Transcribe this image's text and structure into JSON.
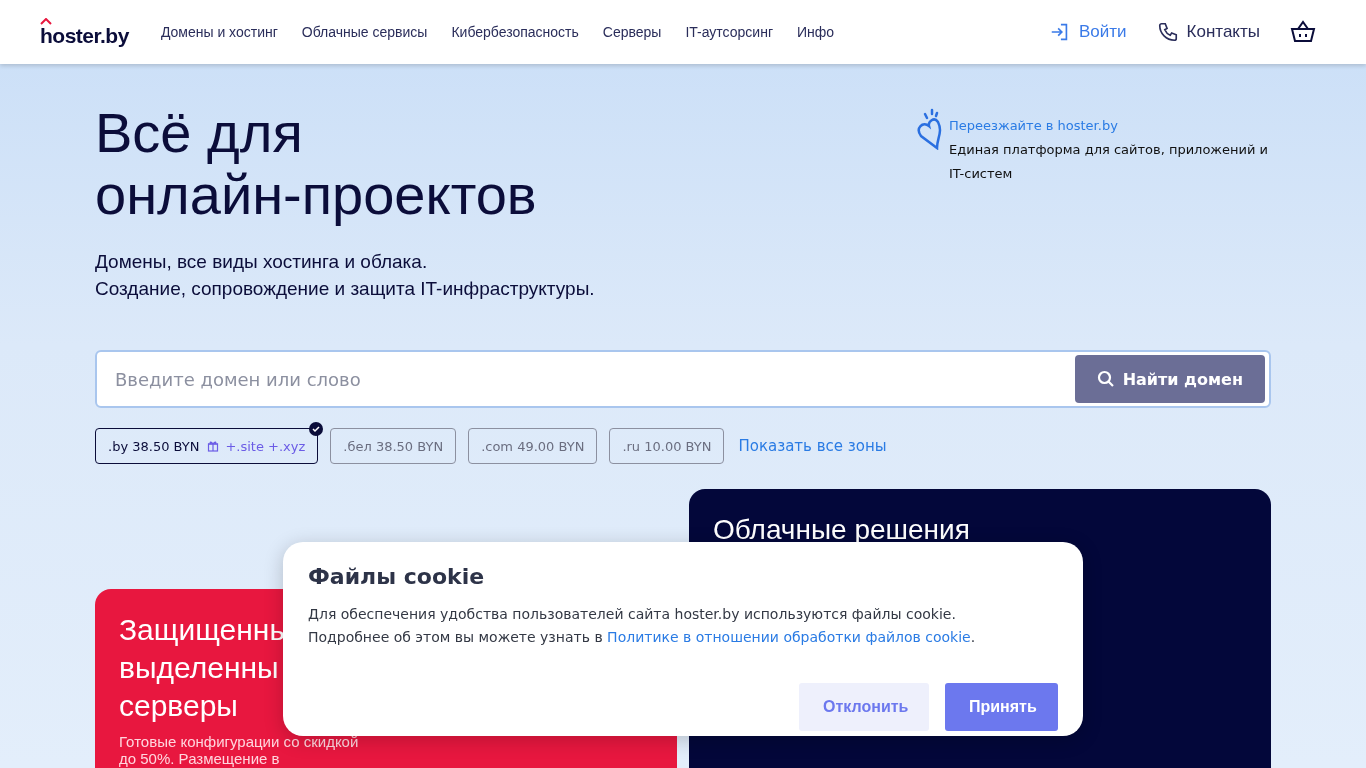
{
  "header": {
    "logo": "hoster.by",
    "nav": [
      "Домены и хостинг",
      "Облачные сервисы",
      "Кибербезопасность",
      "Серверы",
      "IT-аутсорсинг",
      "Инфо"
    ],
    "login": "Войти",
    "contacts": "Контакты"
  },
  "hero": {
    "title_lines": [
      "Всё для",
      "онлайн-проектов"
    ],
    "subtitle_lines": [
      "Домены, все виды хостинга и облака.",
      "Создание, сопровождение и защита IT-инфраструктуры."
    ],
    "promo": {
      "link": "Переезжайте в hoster.by",
      "text": "Единая платформа для сайтов, приложений и IT-систем"
    }
  },
  "search": {
    "placeholder": "Введите домен или слово",
    "button": "Найти домен"
  },
  "zones": [
    {
      "label": ".by 38.50 BYN",
      "bonus": "+.site +.xyz",
      "selected": true
    },
    {
      "label": ".бел 38.50 BYN",
      "selected": false
    },
    {
      "label": ".com 49.00 BYN",
      "selected": false
    },
    {
      "label": ".ru 10.00 BYN",
      "selected": false
    }
  ],
  "show_all": "Показать все зоны",
  "cards": [
    {
      "kind": "promo",
      "title_lines": [
        "Защищенны",
        "выделенны",
        "серверы"
      ],
      "text_lines": [
        "Готовые конфигурации со скидкой",
        "до 50%. Размещение в"
      ]
    },
    {
      "kind": "dark",
      "title_lines": [
        "Облачные решения"
      ]
    }
  ],
  "cookie": {
    "title": "Файлы cookie",
    "text": "Для обеспечения удобства пользователей сайта hoster.by используются файлы cookie.",
    "text2": "Подробнее об этом вы можете узнать в ",
    "link": "Политике в отношении обработки файлов cookie",
    "tail": ".",
    "buttons": [
      {
        "label": "Отклонить",
        "kind": "secondary"
      },
      {
        "label": "Принять",
        "kind": "primary"
      }
    ]
  }
}
